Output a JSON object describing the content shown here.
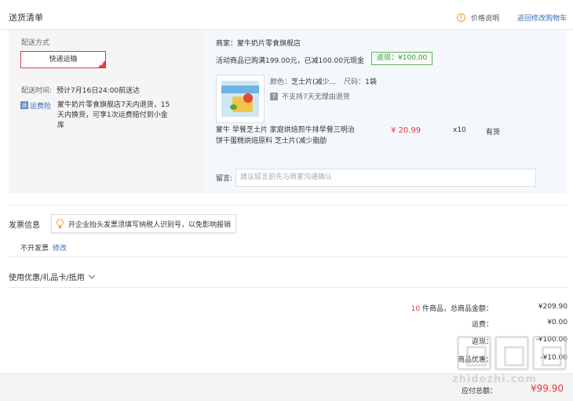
{
  "header": {
    "title": "送货清单",
    "price_info": "价格说明",
    "back_to_cart": "返回修改购物车"
  },
  "shipping": {
    "method_label": "配送方式",
    "method_value": "快递运输",
    "delivery_label": "配送时间:",
    "delivery_value": "预计7月16日24:00前送达",
    "insurance_icon": "运",
    "insurance_label": "运费险",
    "insurance_text": "蒙牛奶片零食旗舰店7天内退货，15天内换货，可享1次运费赔付到小金库"
  },
  "merchant": {
    "label": "商家：",
    "name": "蒙牛奶片零食旗舰店",
    "promo_text": "活动商品已购满199.00元，已减100.00元现金",
    "rebate_label": "返现：",
    "rebate_value": "¥100.00"
  },
  "product": {
    "color_label": "颜色：",
    "color_value": "芝士片(减少...",
    "size_label": "尺码：",
    "size_value": "1袋",
    "no_return_icon": "7",
    "no_return_text": "不支持7天无理由退货",
    "name": "蒙牛 早餐芝士片 家庭烘焙煎牛排早餐三明治饼干蛋糕烘焙原料 芝士片(减少脂肪",
    "price": "¥ 20.99",
    "quantity": "x10",
    "stock": "有货"
  },
  "message": {
    "label": "留言:",
    "placeholder": "建议留言前先与商家沟通确认"
  },
  "invoice": {
    "title": "发票信息",
    "tip": "开企业抬头发票须填写纳税人识别号，以免影响报销",
    "status": "不开发票",
    "edit": "修改"
  },
  "coupon": {
    "label": "使用优惠/礼品卡/抵用"
  },
  "summary": {
    "count": "10",
    "count_suffix": "件商品，总商品金额：",
    "total_goods": "¥209.90",
    "shipping_label": "运费：",
    "shipping_value": "¥0.00",
    "rebate_label": "返现：",
    "rebate_value": "-¥100.00",
    "discount_label": "商品优惠：",
    "discount_value": "-¥10.00"
  },
  "footer": {
    "payable_label": "应付总额：",
    "payable_value": "¥99.90"
  },
  "watermark": {
    "text": "zhidezhi.com"
  },
  "colors": {
    "accent_red": "#e4393c",
    "link_blue": "#3c6bb5",
    "rebate_green": "#3a9a3a"
  }
}
